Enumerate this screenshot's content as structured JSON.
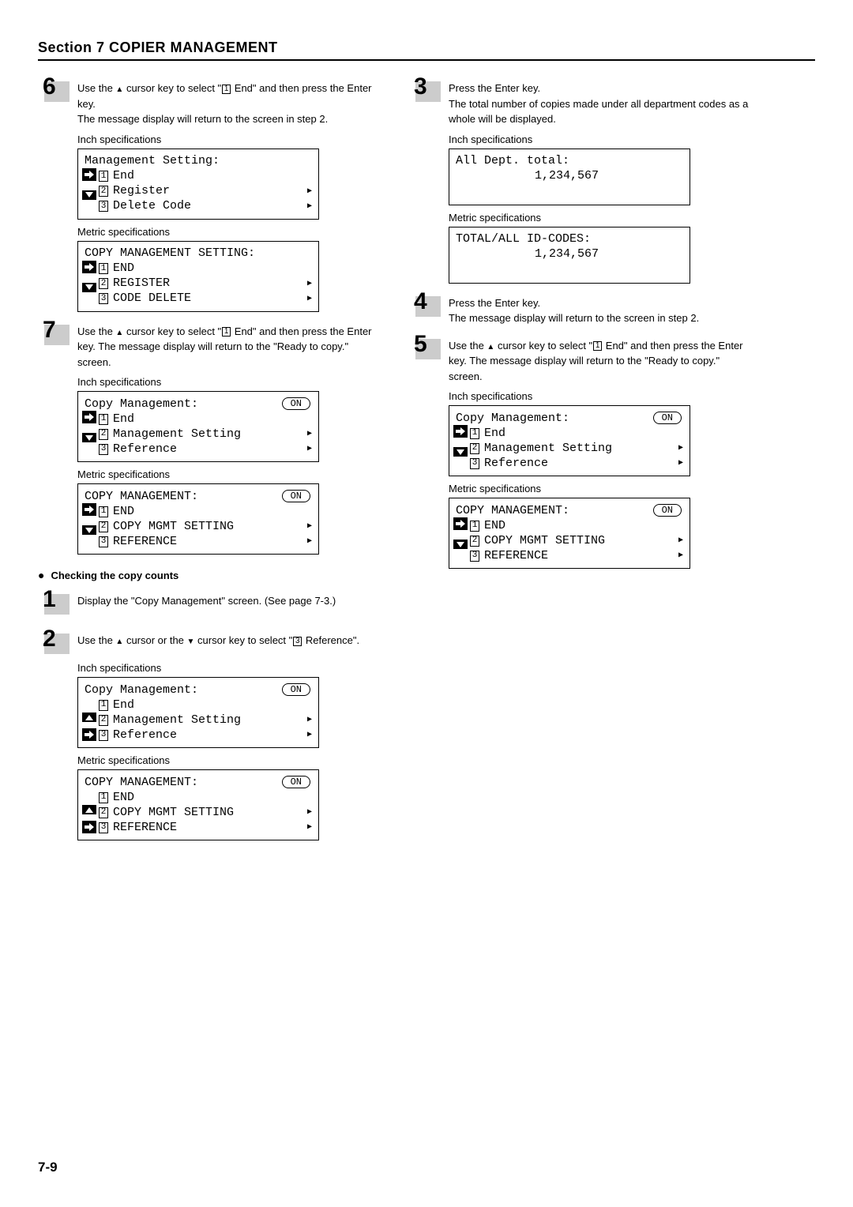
{
  "section": {
    "title": "Section 7  COPIER MANAGEMENT"
  },
  "page_number": "7-9",
  "labels": {
    "inch": "Inch specifications",
    "metric": "Metric specifications"
  },
  "left": {
    "step6": {
      "num": "6",
      "text1": "Use the ",
      "text2": " cursor key to select \"",
      "text3": " End\" and then press the Enter key.",
      "text4": "The message display will return to the screen in step 2.",
      "inline_box": "1",
      "disp_inch_title": "Management Setting:",
      "disp_inch_items": [
        "End",
        "Register",
        "Delete Code"
      ],
      "disp_metric_title": "COPY MANAGEMENT SETTING:",
      "disp_metric_items": [
        "END",
        "REGISTER",
        "CODE DELETE"
      ]
    },
    "step7": {
      "num": "7",
      "text1": "Use the ",
      "text2": " cursor key to select \"",
      "text3": " End\" and then press the Enter key. The message display will return to the \"Ready to copy.\" screen.",
      "inline_box": "1",
      "disp_inch_title": "Copy Management:",
      "disp_inch_badge": "ON",
      "disp_inch_items": [
        "End",
        "Management Setting",
        "Reference"
      ],
      "disp_metric_title": "COPY MANAGEMENT:",
      "disp_metric_badge": "ON",
      "disp_metric_items": [
        "END",
        "COPY MGMT SETTING",
        "REFERENCE"
      ]
    },
    "subheading": "Checking the copy counts",
    "step1": {
      "num": "1",
      "text": "Display the \"Copy Management\" screen. (See page 7-3.)"
    },
    "step2": {
      "num": "2",
      "text1": "Use the ",
      "text2": " cursor or the ",
      "text3": " cursor key to select \"",
      "text4": " Reference\".",
      "inline_box": "3",
      "disp_inch_title": "Copy Management:",
      "disp_inch_badge": "ON",
      "disp_inch_items": [
        "End",
        "Management Setting",
        "Reference"
      ],
      "disp_metric_title": "COPY MANAGEMENT:",
      "disp_metric_badge": "ON",
      "disp_metric_items": [
        "END",
        "COPY MGMT SETTING",
        "REFERENCE"
      ]
    }
  },
  "right": {
    "step3": {
      "num": "3",
      "text1": "Press the Enter key.",
      "text2": "The total number of copies made under all department codes as a whole will be displayed.",
      "disp_inch_title": "All Dept. total:",
      "disp_inch_value": "1,234,567",
      "disp_metric_title": "TOTAL/ALL ID-CODES:",
      "disp_metric_value": "1,234,567"
    },
    "step4": {
      "num": "4",
      "text1": "Press the Enter key.",
      "text2": "The message display will return to the screen in step 2."
    },
    "step5": {
      "num": "5",
      "text1": "Use the ",
      "text2": " cursor key to select \"",
      "text3": " End\" and then press the Enter key. The message display will return to the \"Ready to copy.\" screen.",
      "inline_box": "1",
      "disp_inch_title": "Copy Management:",
      "disp_inch_badge": "ON",
      "disp_inch_items": [
        "End",
        "Management Setting",
        "Reference"
      ],
      "disp_metric_title": "COPY MANAGEMENT:",
      "disp_metric_badge": "ON",
      "disp_metric_items": [
        "END",
        "COPY MGMT SETTING",
        "REFERENCE"
      ]
    }
  }
}
